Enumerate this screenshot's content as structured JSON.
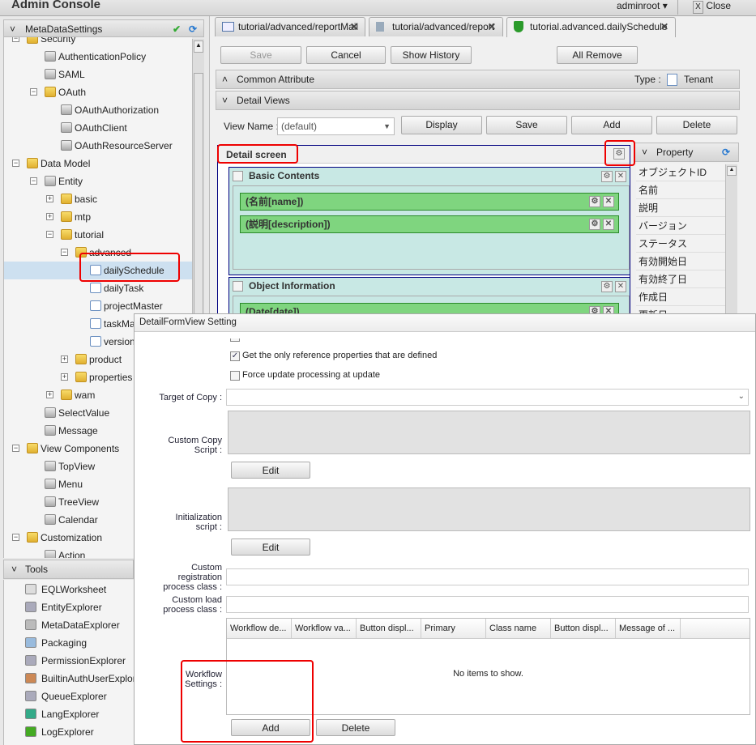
{
  "header": {
    "title": "Admin Console",
    "user": "adminroot",
    "close": "Close"
  },
  "left": {
    "panel_title": "MetaDataSettings",
    "tree": [
      {
        "label": "Security",
        "depth": 1,
        "type": "folder",
        "exp": "−"
      },
      {
        "label": "AuthenticationPolicy",
        "depth": 2,
        "type": "gen"
      },
      {
        "label": "SAML",
        "depth": 2,
        "type": "gen"
      },
      {
        "label": "OAuth",
        "depth": 2,
        "type": "folder",
        "exp": "−"
      },
      {
        "label": "OAuthAuthorization",
        "depth": 3,
        "type": "gen"
      },
      {
        "label": "OAuthClient",
        "depth": 3,
        "type": "gen"
      },
      {
        "label": "OAuthResourceServer",
        "depth": 3,
        "type": "gen"
      },
      {
        "label": "Data Model",
        "depth": 1,
        "type": "folder",
        "exp": "−"
      },
      {
        "label": "Entity",
        "depth": 2,
        "type": "gen",
        "exp": "−"
      },
      {
        "label": "basic",
        "depth": 3,
        "type": "folder",
        "exp": "+"
      },
      {
        "label": "mtp",
        "depth": 3,
        "type": "folder",
        "exp": "+"
      },
      {
        "label": "tutorial",
        "depth": 3,
        "type": "folder",
        "exp": "−"
      },
      {
        "label": "advanced",
        "depth": 4,
        "type": "folder",
        "exp": "−"
      },
      {
        "label": "dailySchedule",
        "depth": 5,
        "type": "doc",
        "selected": true
      },
      {
        "label": "dailyTask",
        "depth": 5,
        "type": "doc"
      },
      {
        "label": "projectMaster",
        "depth": 5,
        "type": "doc"
      },
      {
        "label": "taskMaster",
        "depth": 5,
        "type": "doc"
      },
      {
        "label": "version",
        "depth": 5,
        "type": "doc"
      },
      {
        "label": "product",
        "depth": 4,
        "type": "folder",
        "exp": "+"
      },
      {
        "label": "properties",
        "depth": 4,
        "type": "folder",
        "exp": "+"
      },
      {
        "label": "wam",
        "depth": 3,
        "type": "folder",
        "exp": "+"
      },
      {
        "label": "SelectValue",
        "depth": 2,
        "type": "gen"
      },
      {
        "label": "Message",
        "depth": 2,
        "type": "gen"
      },
      {
        "label": "View Components",
        "depth": 1,
        "type": "folder",
        "exp": "−"
      },
      {
        "label": "TopView",
        "depth": 2,
        "type": "gen"
      },
      {
        "label": "Menu",
        "depth": 2,
        "type": "gen"
      },
      {
        "label": "TreeView",
        "depth": 2,
        "type": "gen"
      },
      {
        "label": "Calendar",
        "depth": 2,
        "type": "gen"
      },
      {
        "label": "Customization",
        "depth": 1,
        "type": "folder",
        "exp": "−"
      },
      {
        "label": "Action",
        "depth": 2,
        "type": "gen"
      }
    ],
    "tools_title": "Tools",
    "tools": [
      "EQLWorksheet",
      "EntityExplorer",
      "MetaDataExplorer",
      "Packaging",
      "PermissionExplorer",
      "BuiltinAuthUserExplorer",
      "QueueExplorer",
      "LangExplorer",
      "LogExplorer"
    ]
  },
  "tabs": [
    {
      "label": "tutorial/advanced/reportMail",
      "icon": "mail-icon"
    },
    {
      "label": "tutorial/advanced/report",
      "icon": "report-icon"
    },
    {
      "label": "tutorial.advanced.dailySchedule",
      "icon": "shield-icon",
      "active": true
    }
  ],
  "toolbar": {
    "save": "Save",
    "cancel": "Cancel",
    "history": "Show History",
    "all_remove": "All Remove"
  },
  "common_attr": {
    "title": "Common Attribute",
    "type_label": "Type :",
    "type_value": "Tenant Local"
  },
  "detail_views": {
    "title": "Detail Views",
    "view_name_label": "View Name :",
    "view_name_value": "(default)",
    "display": "Display",
    "save": "Save",
    "add": "Add",
    "delete": "Delete"
  },
  "editor": {
    "detail_screen": "Detail screen",
    "sections": [
      {
        "title": "Basic Contents",
        "fields": [
          "(名前[name])",
          "(説明[description])"
        ]
      },
      {
        "title": "Object Information",
        "fields": [
          "(Date[date])"
        ]
      }
    ]
  },
  "property": {
    "title": "Property",
    "items": [
      "オブジェクトID",
      "名前",
      "説明",
      "バージョン",
      "ステータス",
      "有効開始日",
      "有効終了日",
      "作成日",
      "更新日"
    ]
  },
  "dialog": {
    "title": "DetailFormView Setting",
    "chk_ref": {
      "label": "Get the only reference properties that are defined",
      "checked": true
    },
    "chk_force": {
      "label": "Force update processing at update",
      "checked": false
    },
    "target_copy_label": "Target of Copy :",
    "target_copy_value": "",
    "copy_script_label1": "Custom Copy",
    "copy_script_label2": "Script :",
    "edit": "Edit",
    "init_label1": "Initialization",
    "init_label2": "script :",
    "reg_label1": "Custom",
    "reg_label2": "registration",
    "reg_label3": "process class :",
    "load_label1": "Custom load",
    "load_label2": "process class :",
    "wf_label1": "Workflow",
    "wf_label2": "Settings :",
    "wf_columns": [
      "Workflow de...",
      "Workflow va...",
      "Button displ...",
      "Primary",
      "Class name",
      "Button displ...",
      "Message of ..."
    ],
    "wf_empty": "No items to show.",
    "add": "Add",
    "delete": "Delete"
  }
}
